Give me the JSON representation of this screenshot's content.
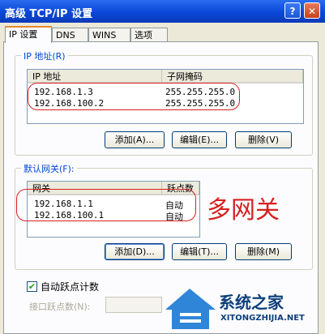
{
  "window": {
    "title": "高级 TCP/IP 设置",
    "help_glyph": "?",
    "close_glyph": "✕"
  },
  "tabs": [
    {
      "label": "IP 设置",
      "active": true
    },
    {
      "label": "DNS",
      "active": false
    },
    {
      "label": "WINS",
      "active": false
    },
    {
      "label": "选项",
      "active": false
    }
  ],
  "ip_group": {
    "title": "IP 地址(R)",
    "columns": [
      "IP 地址",
      "子网掩码"
    ],
    "rows": [
      [
        "192.168.1.3",
        "255.255.255.0"
      ],
      [
        "192.168.100.2",
        "255.255.255.0"
      ]
    ],
    "buttons": {
      "add": "添加(A)...",
      "edit": "编辑(E)...",
      "remove": "删除(V)"
    }
  },
  "gw_group": {
    "title": "默认网关(F):",
    "columns": [
      "网关",
      "跃点数"
    ],
    "rows": [
      [
        "192.168.1.1",
        "自动"
      ],
      [
        "192.168.100.1",
        "自动"
      ]
    ],
    "buttons": {
      "add": "添加(D)...",
      "edit": "编辑(T)...",
      "remove": "删除(M)"
    }
  },
  "annotation": "多网关",
  "auto_metric": {
    "label": "自动跃点计数",
    "checked": true,
    "check_glyph": "✔"
  },
  "interface_metric": {
    "label": "接口跃点数(N):"
  },
  "watermark": {
    "line1": "系统之家",
    "line2": "XITONGZHIJIA.NET"
  },
  "colors": {
    "title_bar": "#0a47d6",
    "annotation_red": "#d62020",
    "group_title": "#0046d5"
  }
}
